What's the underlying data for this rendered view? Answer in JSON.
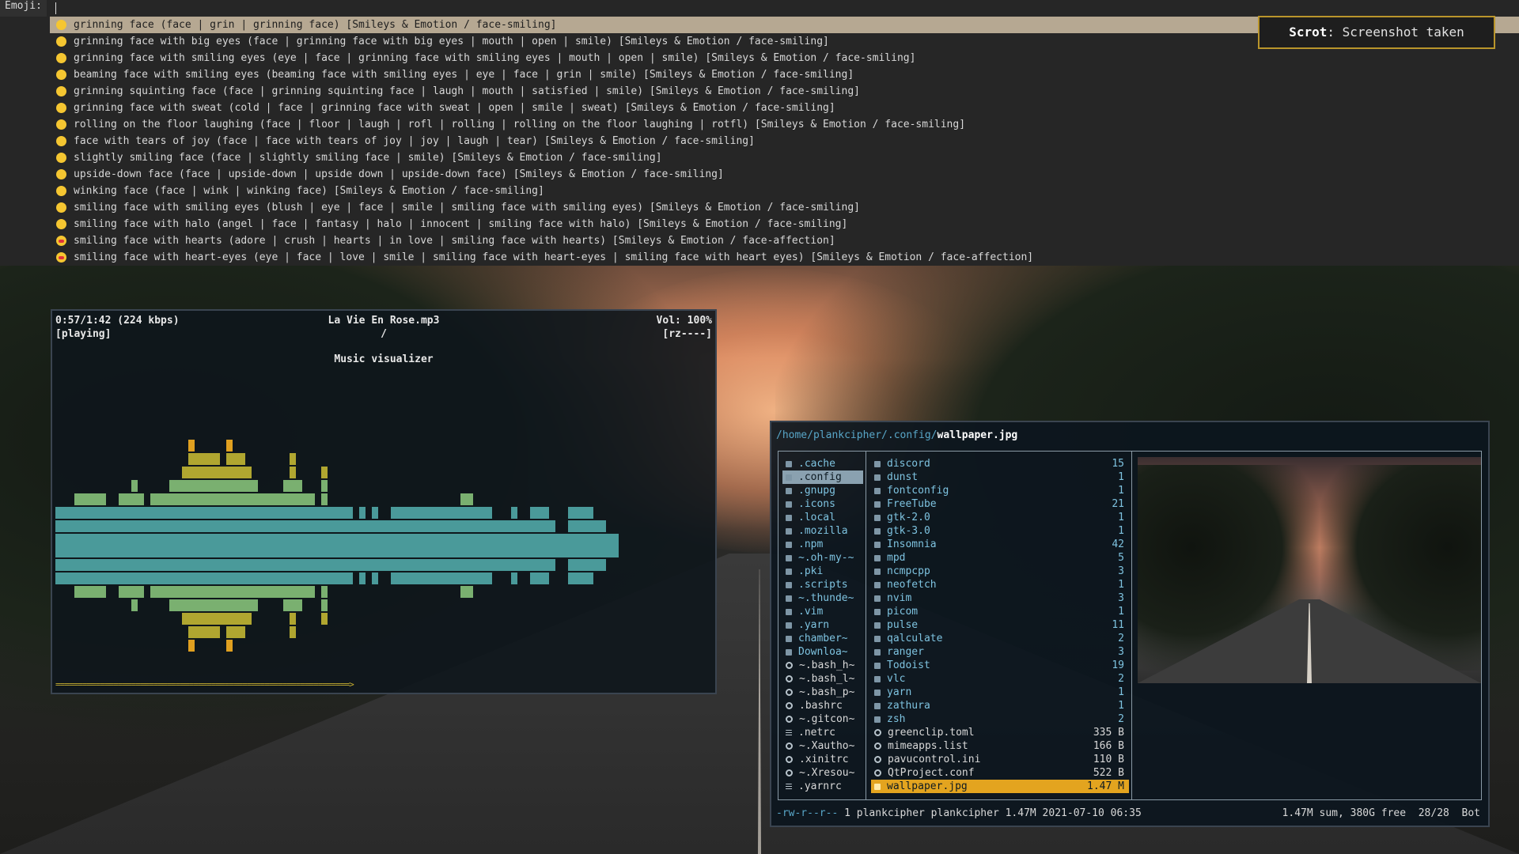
{
  "dmenu": {
    "prompt": "Emoji:",
    "items": [
      {
        "text": "grinning face (face | grin | grinning face) [Smileys & Emotion / face-smiling]",
        "heart": false
      },
      {
        "text": "grinning face with big eyes (face | grinning face with big eyes | mouth | open | smile) [Smileys & Emotion / face-smiling]",
        "heart": false
      },
      {
        "text": "grinning face with smiling eyes (eye | face | grinning face with smiling eyes | mouth | open | smile) [Smileys & Emotion / face-smiling]",
        "heart": false
      },
      {
        "text": "beaming face with smiling eyes (beaming face with smiling eyes | eye | face | grin | smile) [Smileys & Emotion / face-smiling]",
        "heart": false
      },
      {
        "text": "grinning squinting face (face | grinning squinting face | laugh | mouth | satisfied | smile) [Smileys & Emotion / face-smiling]",
        "heart": false
      },
      {
        "text": "grinning face with sweat (cold | face | grinning face with sweat | open | smile | sweat) [Smileys & Emotion / face-smiling]",
        "heart": false
      },
      {
        "text": "rolling on the floor laughing (face | floor | laugh | rofl | rolling | rolling on the floor laughing | rotfl) [Smileys & Emotion / face-smiling]",
        "heart": false
      },
      {
        "text": "face with tears of joy (face | face with tears of joy | joy | laugh | tear) [Smileys & Emotion / face-smiling]",
        "heart": false
      },
      {
        "text": "slightly smiling face (face | slightly smiling face | smile) [Smileys & Emotion / face-smiling]",
        "heart": false
      },
      {
        "text": "upside-down face (face | upside-down | upside down | upside-down face) [Smileys & Emotion / face-smiling]",
        "heart": false
      },
      {
        "text": "winking face (face | wink | winking face) [Smileys & Emotion / face-smiling]",
        "heart": false
      },
      {
        "text": "smiling face with smiling eyes (blush | eye | face | smile | smiling face with smiling eyes) [Smileys & Emotion / face-smiling]",
        "heart": false
      },
      {
        "text": "smiling face with halo (angel | face | fantasy | halo | innocent | smiling face with halo) [Smileys & Emotion / face-smiling]",
        "heart": false
      },
      {
        "text": "smiling face with hearts (adore | crush | hearts | in love | smiling face with hearts) [Smileys & Emotion / face-affection]",
        "heart": true
      },
      {
        "text": "smiling face with heart-eyes (eye | face | love | smile | smiling face with heart-eyes | smiling face with heart eyes) [Smileys & Emotion / face-affection]",
        "heart": true
      }
    ]
  },
  "notification": {
    "app": "Scrot",
    "message": ": Screenshot taken"
  },
  "ncmpcpp": {
    "time": "0:57/1:42 (224 kbps)",
    "state": "[playing]",
    "song": "La Vie En Rose.mp3",
    "song_sub": "/",
    "volume": "Vol: 100%",
    "flags": "[rz----]",
    "visualizer_title": "Music visualizer",
    "progress": "==================================================================>",
    "visualizer_levels": [
      3,
      3,
      3,
      4,
      4,
      4,
      4,
      4,
      3,
      3,
      4,
      4,
      5,
      4,
      3,
      4,
      4,
      4,
      5,
      5,
      6,
      8,
      7,
      7,
      7,
      7,
      6,
      8,
      7,
      7,
      6,
      5,
      4,
      4,
      4,
      4,
      5,
      7,
      5,
      4,
      4,
      3,
      6,
      3,
      3,
      3,
      3,
      2,
      3,
      2,
      3,
      2,
      2,
      3,
      3,
      3,
      3,
      3,
      3,
      3,
      3,
      3,
      3,
      3,
      4,
      4,
      3,
      3,
      3,
      2,
      2,
      2,
      3,
      2,
      2,
      3,
      3,
      3,
      2,
      1,
      1,
      3,
      3,
      3,
      3,
      2,
      2,
      1,
      1,
      0,
      0,
      0,
      0,
      0,
      0,
      0,
      0
    ]
  },
  "ranger": {
    "path_dir": "/home/plankcipher/.config/",
    "path_file": "wallpaper.jpg",
    "parent": [
      {
        "name": ".cache",
        "icon": "folder",
        "dir": true
      },
      {
        "name": ".config",
        "icon": "folder",
        "dir": true,
        "selected": true
      },
      {
        "name": ".gnupg",
        "icon": "folder",
        "dir": true
      },
      {
        "name": ".icons",
        "icon": "folder",
        "dir": true
      },
      {
        "name": ".local",
        "icon": "folder",
        "dir": true
      },
      {
        "name": ".mozilla",
        "icon": "folder",
        "dir": true
      },
      {
        "name": ".npm",
        "icon": "folder",
        "dir": true
      },
      {
        "name": "~.oh-my-~",
        "icon": "folder",
        "dir": true
      },
      {
        "name": ".pki",
        "icon": "folder",
        "dir": true
      },
      {
        "name": ".scripts",
        "icon": "folder",
        "dir": true
      },
      {
        "name": "~.thunde~",
        "icon": "folder",
        "dir": true
      },
      {
        "name": ".vim",
        "icon": "folder",
        "dir": true
      },
      {
        "name": ".yarn",
        "icon": "folder",
        "dir": true
      },
      {
        "name": "chamber~",
        "icon": "folder",
        "dir": true
      },
      {
        "name": "Downloa~",
        "icon": "folder",
        "dir": true
      },
      {
        "name": "~.bash_h~",
        "icon": "config",
        "dir": false
      },
      {
        "name": "~.bash_l~",
        "icon": "config",
        "dir": false
      },
      {
        "name": "~.bash_p~",
        "icon": "config",
        "dir": false
      },
      {
        "name": ".bashrc",
        "icon": "config",
        "dir": false
      },
      {
        "name": "~.gitcon~",
        "icon": "config",
        "dir": false
      },
      {
        "name": ".netrc",
        "icon": "text",
        "dir": false
      },
      {
        "name": "~.Xautho~",
        "icon": "config",
        "dir": false
      },
      {
        "name": ".xinitrc",
        "icon": "config",
        "dir": false
      },
      {
        "name": "~.Xresou~",
        "icon": "config",
        "dir": false
      },
      {
        "name": ".yarnrc",
        "icon": "text",
        "dir": false
      }
    ],
    "current": [
      {
        "name": "discord",
        "size": "15",
        "icon": "folder",
        "dir": true
      },
      {
        "name": "dunst",
        "size": "1",
        "icon": "folder",
        "dir": true
      },
      {
        "name": "fontconfig",
        "size": "1",
        "icon": "folder",
        "dir": true
      },
      {
        "name": "FreeTube",
        "size": "21",
        "icon": "folder",
        "dir": true
      },
      {
        "name": "gtk-2.0",
        "size": "1",
        "icon": "folder",
        "dir": true
      },
      {
        "name": "gtk-3.0",
        "size": "1",
        "icon": "folder",
        "dir": true
      },
      {
        "name": "Insomnia",
        "size": "42",
        "icon": "folder",
        "dir": true
      },
      {
        "name": "mpd",
        "size": "5",
        "icon": "folder",
        "dir": true
      },
      {
        "name": "ncmpcpp",
        "size": "3",
        "icon": "folder",
        "dir": true
      },
      {
        "name": "neofetch",
        "size": "1",
        "icon": "folder",
        "dir": true
      },
      {
        "name": "nvim",
        "size": "3",
        "icon": "folder",
        "dir": true
      },
      {
        "name": "picom",
        "size": "1",
        "icon": "folder",
        "dir": true
      },
      {
        "name": "pulse",
        "size": "11",
        "icon": "folder",
        "dir": true
      },
      {
        "name": "qalculate",
        "size": "2",
        "icon": "folder",
        "dir": true
      },
      {
        "name": "ranger",
        "size": "3",
        "icon": "folder",
        "dir": true
      },
      {
        "name": "Todoist",
        "size": "19",
        "icon": "folder",
        "dir": true
      },
      {
        "name": "vlc",
        "size": "2",
        "icon": "folder",
        "dir": true
      },
      {
        "name": "yarn",
        "size": "1",
        "icon": "folder",
        "dir": true
      },
      {
        "name": "zathura",
        "size": "1",
        "icon": "folder",
        "dir": true
      },
      {
        "name": "zsh",
        "size": "2",
        "icon": "folder",
        "dir": true
      },
      {
        "name": "greenclip.toml",
        "size": "335 B",
        "icon": "config",
        "dir": false
      },
      {
        "name": "mimeapps.list",
        "size": "166 B",
        "icon": "config",
        "dir": false
      },
      {
        "name": "pavucontrol.ini",
        "size": "110 B",
        "icon": "config",
        "dir": false
      },
      {
        "name": "QtProject.conf",
        "size": "522 B",
        "icon": "config",
        "dir": false
      },
      {
        "name": "wallpaper.jpg",
        "size": "1.47 M",
        "icon": "image",
        "dir": false,
        "selected": true
      }
    ],
    "status": {
      "perms": "-rw-r--r--",
      "info": " 1 plankcipher plankcipher 1.47M 2021-07-10 06:35",
      "right": "1.47M sum, 380G free  28/28  Bot"
    }
  },
  "colors": {
    "dmenu_selected": "#b6a892",
    "notify_border": "#b9952b",
    "ranger_selected": "#e3a41f"
  }
}
